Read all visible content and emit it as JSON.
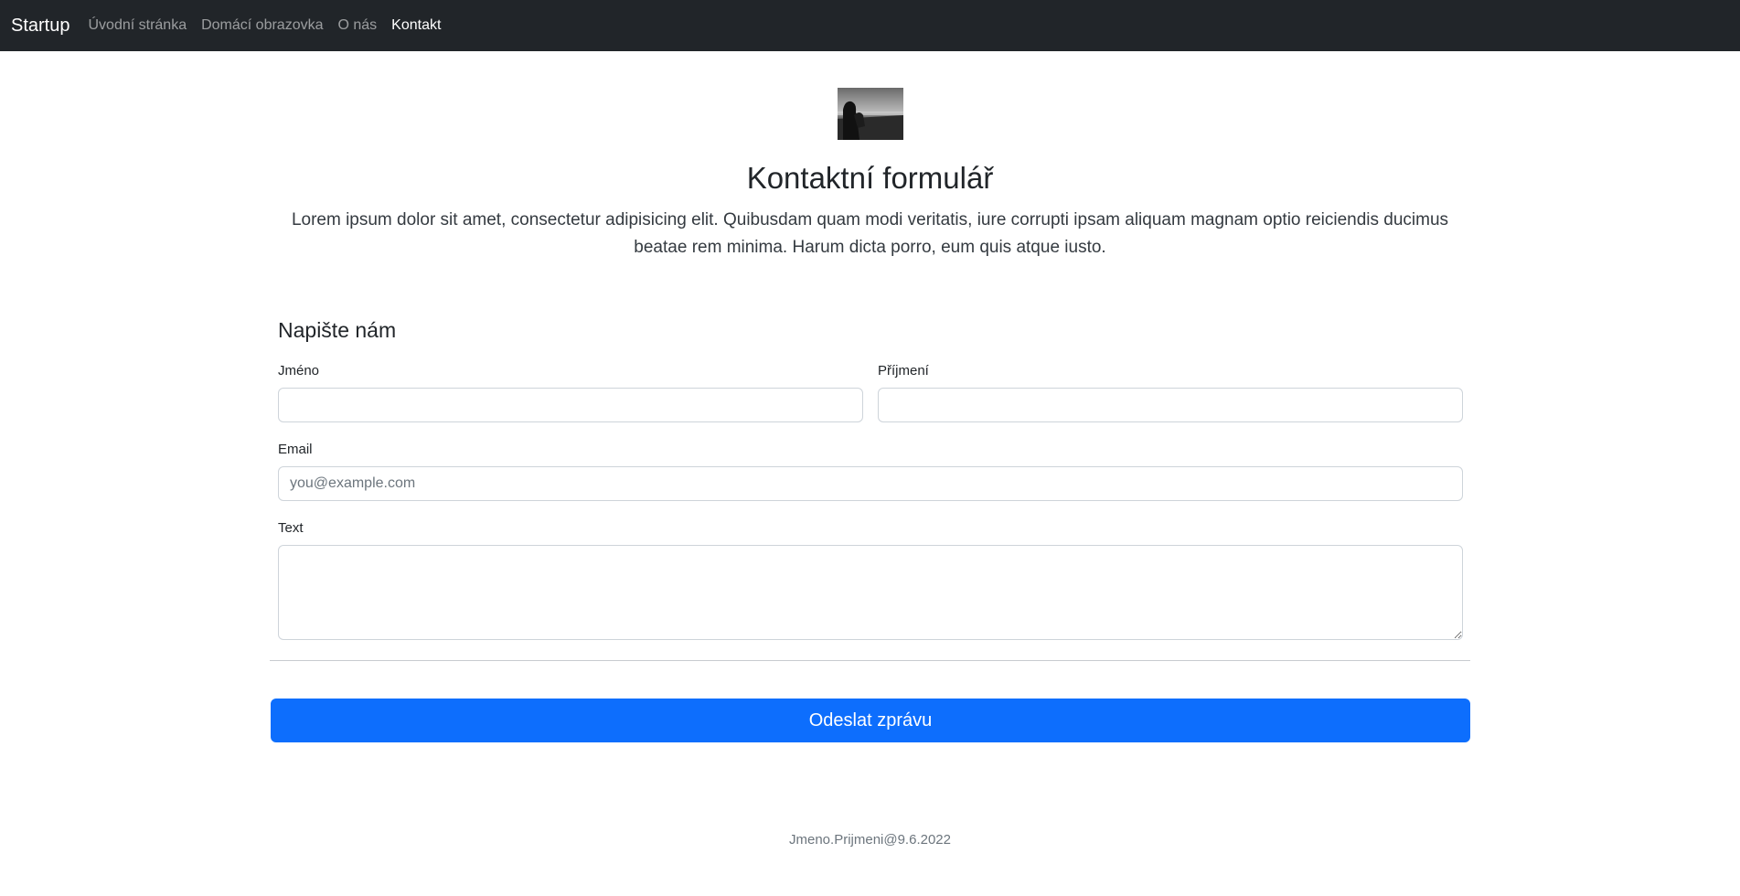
{
  "navbar": {
    "brand": "Startup",
    "items": [
      {
        "label": "Úvodní stránka",
        "active": false
      },
      {
        "label": "Domácí obrazovka",
        "active": false
      },
      {
        "label": "O nás",
        "active": false
      },
      {
        "label": "Kontakt",
        "active": true
      }
    ]
  },
  "hero": {
    "title": "Kontaktní formulář",
    "lead": "Lorem ipsum dolor sit amet, consectetur adipisicing elit. Quibusdam quam modi veritatis, iure corrupti ipsam aliquam magnam optio reiciendis ducimus beatae rem minima. Harum dicta porro, eum quis atque iusto."
  },
  "form": {
    "title": "Napište nám",
    "first_name": {
      "label": "Jméno",
      "value": "",
      "placeholder": ""
    },
    "last_name": {
      "label": "Příjmení",
      "value": "",
      "placeholder": ""
    },
    "email": {
      "label": "Email",
      "value": "",
      "placeholder": "you@example.com"
    },
    "text": {
      "label": "Text",
      "value": "",
      "placeholder": ""
    },
    "submit_label": "Odeslat zprávu"
  },
  "footer": {
    "text": "Jmeno.Prijmeni@9.6.2022"
  },
  "colors": {
    "navbar_bg": "#212529",
    "primary": "#0d6efd",
    "muted": "#6c757d"
  }
}
